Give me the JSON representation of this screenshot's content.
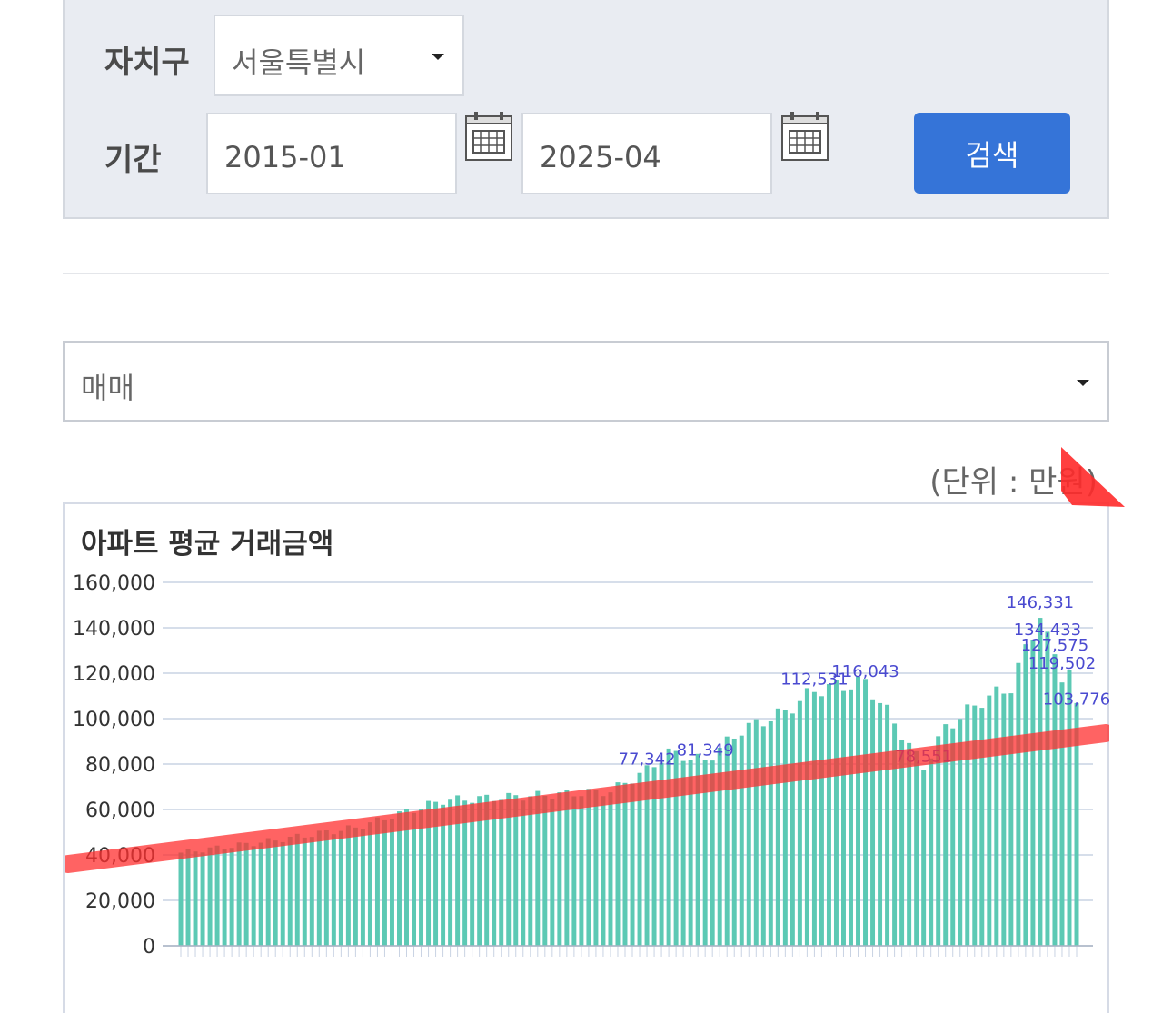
{
  "filters": {
    "district_label": "자치구",
    "district_value": "서울특별시",
    "period_label": "기간",
    "start_date": "2015-01",
    "end_date": "2025-04",
    "search_label": "검색"
  },
  "trade_type": {
    "value": "매매"
  },
  "unit_note": "(단위 : 만원)",
  "colors": {
    "bar": "#5cc9b4",
    "label": "#4a4ad0",
    "accent": "#3574d8",
    "trend": "#ff3030"
  },
  "chart_data": {
    "type": "bar",
    "title": "아파트 평균 거래금액",
    "xlabel": "",
    "ylabel": "",
    "ylim": [
      0,
      160000
    ],
    "yticks": [
      "0",
      "20,000",
      "40,000",
      "60,000",
      "80,000",
      "100,000",
      "120,000",
      "140,000",
      "160,000"
    ],
    "grid": true,
    "start_month": "2015-01",
    "end_month": "2025-04",
    "labeled_points": [
      {
        "x": "2020-05",
        "y": 77342,
        "label": "77,342"
      },
      {
        "x": "2021-01",
        "y": 81349,
        "label": "81,349"
      },
      {
        "x": "2022-04",
        "y": 112531,
        "label": "112,531"
      },
      {
        "x": "2022-11",
        "y": 116043,
        "label": "116,043"
      },
      {
        "x": "2023-07",
        "y": 78551,
        "label": "78,551"
      },
      {
        "x": "2024-11",
        "y": 146331,
        "label": "146,331"
      },
      {
        "x": "2024-12",
        "y": 134433,
        "label": "134,433"
      },
      {
        "x": "2025-01",
        "y": 127575,
        "label": "127,575"
      },
      {
        "x": "2025-02",
        "y": 119502,
        "label": "119,502"
      },
      {
        "x": "2025-04",
        "y": 103776,
        "label": "103,776"
      }
    ],
    "trendline": {
      "from": {
        "x": "2015-01",
        "y": 40000
      },
      "to": {
        "x": "2025-04",
        "y": 96000
      }
    }
  }
}
